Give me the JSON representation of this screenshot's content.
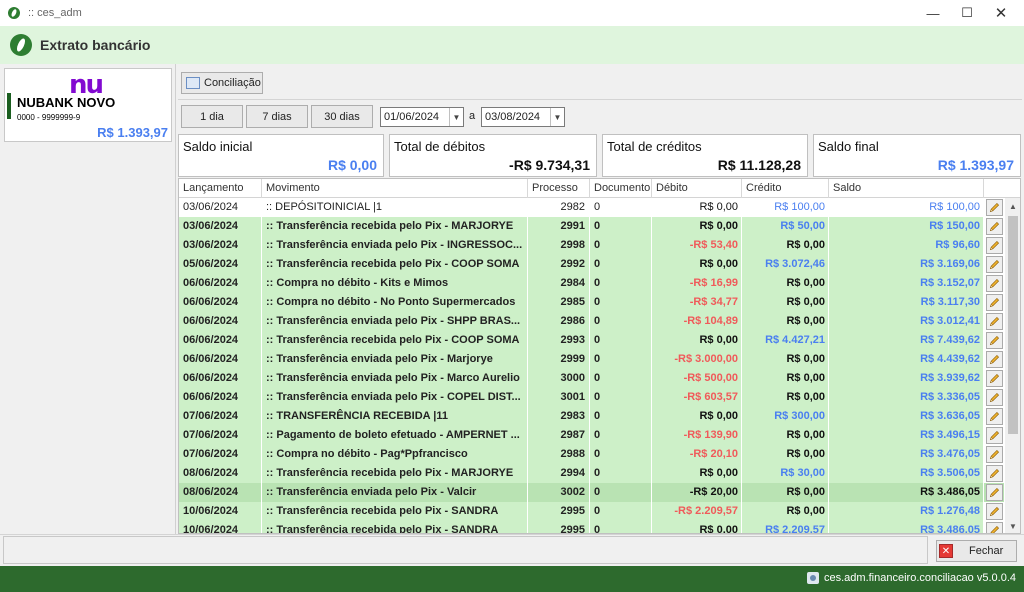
{
  "window": {
    "title": ":: ces_adm"
  },
  "header": {
    "title": "Extrato bancário"
  },
  "account": {
    "logo_text": "nu",
    "name": "NUBANK NOVO",
    "number": "0000 - 9999999-9",
    "balance": "R$ 1.393,97"
  },
  "toolbar": {
    "conciliacao_label": "Conciliação"
  },
  "filters": {
    "btn_1dia": "1 dia",
    "btn_7dias": "7 dias",
    "btn_30dias": "30 dias",
    "date_from": "01/06/2024",
    "separator": "a",
    "date_to": "03/08/2024"
  },
  "summary": {
    "saldo_inicial": {
      "label": "Saldo inicial",
      "value": "R$ 0,00"
    },
    "total_debitos": {
      "label": "Total de débitos",
      "value": "-R$ 9.734,31"
    },
    "total_creditos": {
      "label": "Total de créditos",
      "value": "R$ 11.128,28"
    },
    "saldo_final": {
      "label": "Saldo final",
      "value": "R$ 1.393,97"
    }
  },
  "table": {
    "columns": [
      "Lançamento",
      "Movimento",
      "Processo",
      "Documento",
      "Débito",
      "Crédito",
      "Saldo"
    ],
    "rows": [
      {
        "style": "white",
        "date": "03/06/2024",
        "mov": ":: DEPÓSITOINICIAL |1",
        "proc": "2982",
        "doc": "0",
        "deb": "R$ 0,00",
        "deb_t": "zero",
        "cred": "R$ 100,00",
        "cred_t": "pos",
        "saldo": "R$ 100,00",
        "saldo_t": "pos"
      },
      {
        "style": "green",
        "date": "03/06/2024",
        "mov": ":: Transferência recebida pelo Pix - MARJORYE",
        "proc": "2991",
        "doc": "0",
        "deb": "R$ 0,00",
        "deb_t": "zero",
        "cred": "R$ 50,00",
        "cred_t": "pos",
        "saldo": "R$ 150,00",
        "saldo_t": "pos"
      },
      {
        "style": "green",
        "date": "03/06/2024",
        "mov": ":: Transferência enviada pelo Pix - INGRESSOC...",
        "proc": "2998",
        "doc": "0",
        "deb": "-R$ 53,40",
        "deb_t": "neg",
        "cred": "R$ 0,00",
        "cred_t": "zero",
        "saldo": "R$ 96,60",
        "saldo_t": "pos"
      },
      {
        "style": "green",
        "date": "05/06/2024",
        "mov": ":: Transferência recebida pelo Pix - COOP SOMA",
        "proc": "2992",
        "doc": "0",
        "deb": "R$ 0,00",
        "deb_t": "zero",
        "cred": "R$ 3.072,46",
        "cred_t": "pos",
        "saldo": "R$ 3.169,06",
        "saldo_t": "pos"
      },
      {
        "style": "green",
        "date": "06/06/2024",
        "mov": ":: Compra no débito - Kits e Mimos",
        "proc": "2984",
        "doc": "0",
        "deb": "-R$ 16,99",
        "deb_t": "neg",
        "cred": "R$ 0,00",
        "cred_t": "zero",
        "saldo": "R$ 3.152,07",
        "saldo_t": "pos"
      },
      {
        "style": "green",
        "date": "06/06/2024",
        "mov": ":: Compra no débito - No Ponto Supermercados",
        "proc": "2985",
        "doc": "0",
        "deb": "-R$ 34,77",
        "deb_t": "neg",
        "cred": "R$ 0,00",
        "cred_t": "zero",
        "saldo": "R$ 3.117,30",
        "saldo_t": "pos"
      },
      {
        "style": "green",
        "date": "06/06/2024",
        "mov": ":: Transferência enviada pelo Pix - SHPP BRAS...",
        "proc": "2986",
        "doc": "0",
        "deb": "-R$ 104,89",
        "deb_t": "neg",
        "cred": "R$ 0,00",
        "cred_t": "zero",
        "saldo": "R$ 3.012,41",
        "saldo_t": "pos"
      },
      {
        "style": "green",
        "date": "06/06/2024",
        "mov": ":: Transferência recebida pelo Pix - COOP SOMA",
        "proc": "2993",
        "doc": "0",
        "deb": "R$ 0,00",
        "deb_t": "zero",
        "cred": "R$ 4.427,21",
        "cred_t": "pos",
        "saldo": "R$ 7.439,62",
        "saldo_t": "pos"
      },
      {
        "style": "green",
        "date": "06/06/2024",
        "mov": ":: Transferência enviada pelo Pix - Marjorye",
        "proc": "2999",
        "doc": "0",
        "deb": "-R$ 3.000,00",
        "deb_t": "neg",
        "cred": "R$ 0,00",
        "cred_t": "zero",
        "saldo": "R$ 4.439,62",
        "saldo_t": "pos"
      },
      {
        "style": "green",
        "date": "06/06/2024",
        "mov": ":: Transferência enviada pelo Pix - Marco Aurelio",
        "proc": "3000",
        "doc": "0",
        "deb": "-R$ 500,00",
        "deb_t": "neg",
        "cred": "R$ 0,00",
        "cred_t": "zero",
        "saldo": "R$ 3.939,62",
        "saldo_t": "pos"
      },
      {
        "style": "green",
        "date": "06/06/2024",
        "mov": ":: Transferência enviada pelo Pix - COPEL DIST...",
        "proc": "3001",
        "doc": "0",
        "deb": "-R$ 603,57",
        "deb_t": "neg",
        "cred": "R$ 0,00",
        "cred_t": "zero",
        "saldo": "R$ 3.336,05",
        "saldo_t": "pos"
      },
      {
        "style": "green",
        "date": "07/06/2024",
        "mov": ":: TRANSFERÊNCIA RECEBIDA |11",
        "proc": "2983",
        "doc": "0",
        "deb": "R$ 0,00",
        "deb_t": "zero",
        "cred": "R$ 300,00",
        "cred_t": "pos",
        "saldo": "R$ 3.636,05",
        "saldo_t": "pos"
      },
      {
        "style": "green",
        "date": "07/06/2024",
        "mov": ":: Pagamento de boleto efetuado - AMPERNET ...",
        "proc": "2987",
        "doc": "0",
        "deb": "-R$ 139,90",
        "deb_t": "neg",
        "cred": "R$ 0,00",
        "cred_t": "zero",
        "saldo": "R$ 3.496,15",
        "saldo_t": "pos"
      },
      {
        "style": "green",
        "date": "07/06/2024",
        "mov": ":: Compra no débito - Pag*Ppfrancisco",
        "proc": "2988",
        "doc": "0",
        "deb": "-R$ 20,10",
        "deb_t": "neg",
        "cred": "R$ 0,00",
        "cred_t": "zero",
        "saldo": "R$ 3.476,05",
        "saldo_t": "pos"
      },
      {
        "style": "green",
        "date": "08/06/2024",
        "mov": ":: Transferência recebida pelo Pix - MARJORYE",
        "proc": "2994",
        "doc": "0",
        "deb": "R$ 0,00",
        "deb_t": "zero",
        "cred": "R$ 30,00",
        "cred_t": "pos",
        "saldo": "R$ 3.506,05",
        "saldo_t": "pos"
      },
      {
        "style": "green selected",
        "date": "08/06/2024",
        "mov": ":: Transferência enviada pelo Pix - Valcir",
        "proc": "3002",
        "doc": "0",
        "deb": "-R$ 20,00",
        "deb_t": "zero",
        "cred": "R$ 0,00",
        "cred_t": "zero",
        "saldo": "R$ 3.486,05",
        "saldo_t": "zero"
      },
      {
        "style": "green",
        "date": "10/06/2024",
        "mov": ":: Transferência recebida pelo Pix - SANDRA",
        "proc": "2995",
        "doc": "0",
        "deb": "-R$ 2.209,57",
        "deb_t": "neg",
        "cred": "R$ 0,00",
        "cred_t": "zero",
        "saldo": "R$ 1.276,48",
        "saldo_t": "pos"
      },
      {
        "style": "green",
        "date": "10/06/2024",
        "mov": ":: Transferência recebida pelo Pix - SANDRA",
        "proc": "2995",
        "doc": "0",
        "deb": "R$ 0,00",
        "deb_t": "zero",
        "cred": "R$ 2.209,57",
        "cred_t": "pos",
        "saldo": "R$ 3.486,05",
        "saldo_t": "pos"
      }
    ]
  },
  "footer": {
    "close_label": "Fechar",
    "status": "ces.adm.financeiro.conciliacao v5.0.0.4"
  },
  "colors": {
    "status_bar": "#2d6a2d",
    "header_bg": "#dff5dd",
    "row_green": "#cdf0c8",
    "negative": "#f05a5a",
    "positive": "#4a7ff0",
    "nubank": "#820ad1"
  },
  "icons": [
    "app-logo-icon",
    "minimize-icon",
    "maximize-icon",
    "close-icon",
    "conciliacao-icon",
    "dropdown-icon",
    "edit-pencil-icon",
    "close-red-icon",
    "status-app-icon"
  ]
}
